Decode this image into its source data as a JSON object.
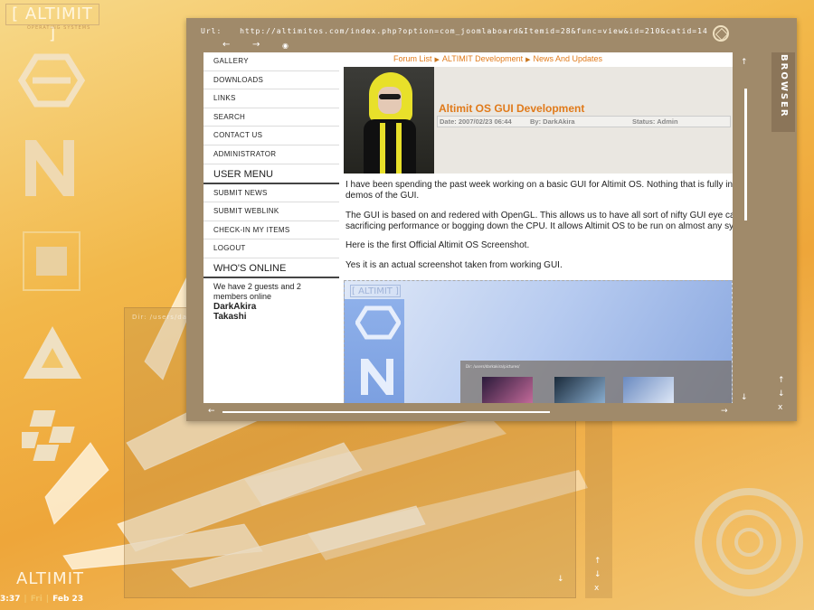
{
  "desktop": {
    "brand": "[ ALTIMIT ]",
    "brand_sub": "OPERATING SYSTEMS",
    "dock_brand": "ALTIMIT",
    "clock": {
      "time": "3:37",
      "day": "Fri",
      "date": "Feb 23"
    }
  },
  "browser": {
    "url_label": "Url:",
    "url": "http://altimitos.com/index.php?option=com_joomlaboard&Itemid=28&func=view&id=210&catid=14",
    "side_label": "BROWSER",
    "back_glyph": "←",
    "forward_glyph": "→",
    "refresh_glyph": "◉"
  },
  "secondary_window": {
    "url": "Dir: /users/dar"
  },
  "site": {
    "main_menu": [
      "GALLERY",
      "DOWNLOADS",
      "LINKS",
      "SEARCH",
      "CONTACT US",
      "ADMINISTRATOR"
    ],
    "user_menu": {
      "title": "USER MENU",
      "items": [
        "SUBMIT NEWS",
        "SUBMIT WEBLINK",
        "CHECK-IN MY ITEMS",
        "LOGOUT"
      ]
    },
    "whos_online": {
      "title": "WHO'S ONLINE",
      "text": "We have 2 guests and 2 members online",
      "members": [
        "DarkAkira",
        "Takashi"
      ]
    },
    "breadcrumb": [
      "Forum List",
      "ALTIMIT Development",
      "News And Updates"
    ],
    "post": {
      "title": "Altimit OS GUI Development",
      "date": "Date: 2007/02/23 06:44",
      "author": "By: DarkAkira",
      "status": "Status: Admin",
      "paragraphs": [
        "I have been spending the past week working on a basic GUI for Altimit OS. Nothing that is fully integ",
        "demos of the GUI.",
        "The GUI is based on and redered with OpenGL. This allows us to have all sort of nifty GUI eye candi",
        "sacrificing performance or bogging down the CPU. It allows Altimit OS to be run on almost any syste",
        "Here is the first Official Altimit OS Screenshot.",
        "Yes it is an actual screenshot taken from working GUI."
      ],
      "screenshot_brand": "[ ALTIMIT ]",
      "screenshot_url": "Dir: /users/darkakira/pictures/"
    }
  },
  "colors": {
    "accent": "#e07a1a",
    "frame": "#a08a6a",
    "desktop": "#eea63a"
  }
}
